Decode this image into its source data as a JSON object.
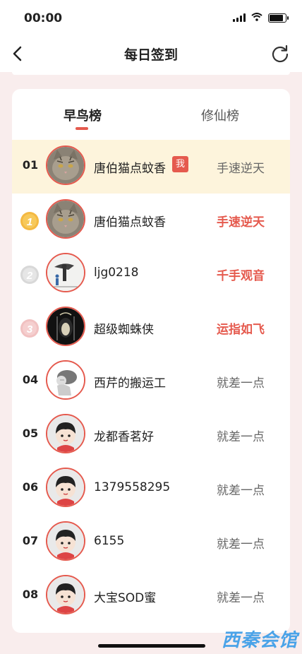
{
  "status": {
    "time": "00:00"
  },
  "nav": {
    "title": "每日签到"
  },
  "tabs": [
    {
      "label": "早鸟榜"
    },
    {
      "label": "修仙榜"
    }
  ],
  "me_row": {
    "rank": "01",
    "name": "唐伯猫点蚊香",
    "badge": "我",
    "title": "手速逆天",
    "avatar": "cat"
  },
  "rows": [
    {
      "rank": "1",
      "medal": "gold",
      "name": "唐伯猫点蚊香",
      "title": "手速逆天",
      "title_color": "red",
      "avatar": "cat"
    },
    {
      "rank": "2",
      "medal": "silver",
      "name": "ljg0218",
      "title": "千手观音",
      "title_color": "red",
      "avatar": "silhouette"
    },
    {
      "rank": "3",
      "medal": "bronze",
      "name": "超级蜘蛛侠",
      "title": "运指如飞",
      "title_color": "red",
      "avatar": "dark"
    },
    {
      "rank": "04",
      "name": "西芹的搬运工",
      "title": "就差一点",
      "title_color": "gray",
      "avatar": "porter"
    },
    {
      "rank": "05",
      "name": "龙都香茗好",
      "title": "就差一点",
      "title_color": "gray",
      "avatar": "cartoon"
    },
    {
      "rank": "06",
      "name": "1379558295",
      "title": "就差一点",
      "title_color": "gray",
      "avatar": "cartoon"
    },
    {
      "rank": "07",
      "name": "6155",
      "title": "就差一点",
      "title_color": "gray",
      "avatar": "cartoon"
    },
    {
      "rank": "08",
      "name": "大宝SOD蜜",
      "title": "就差一点",
      "title_color": "gray",
      "avatar": "cartoon"
    }
  ],
  "watermark": "西秦会馆",
  "colors": {
    "accent": "#e55a4e",
    "me_bg": "#fdf4dc",
    "page_bg": "#f9eded"
  }
}
